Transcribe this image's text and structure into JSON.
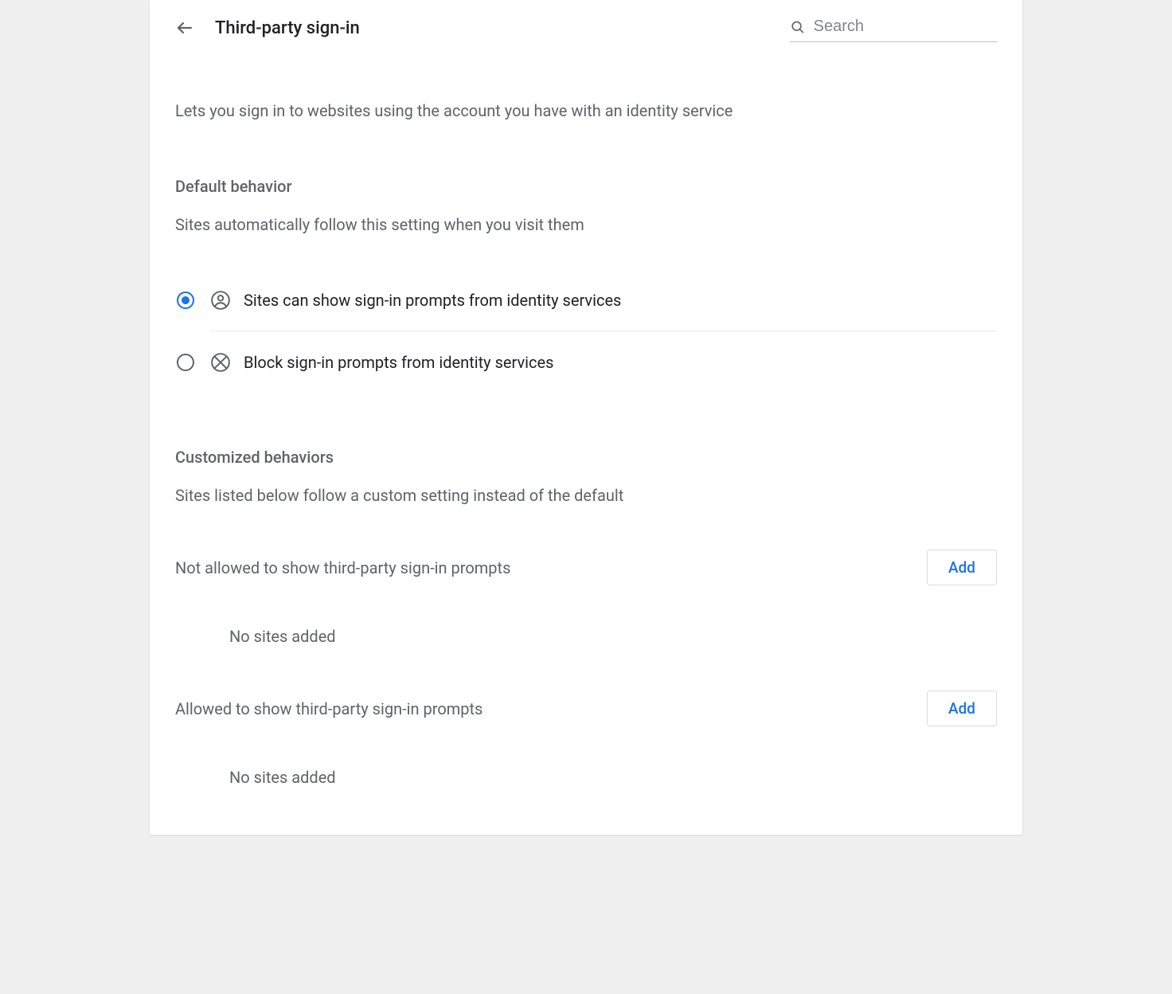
{
  "header": {
    "title": "Third-party sign-in",
    "search_placeholder": "Search"
  },
  "description": "Lets you sign in to websites using the account you have with an identity service",
  "default_section": {
    "title": "Default behavior",
    "subtitle": "Sites automatically follow this setting when you visit them",
    "options": [
      {
        "label": "Sites can show sign-in prompts from identity services",
        "selected": true
      },
      {
        "label": "Block sign-in prompts from identity services",
        "selected": false
      }
    ]
  },
  "custom_section": {
    "title": "Customized behaviors",
    "subtitle": "Sites listed below follow a custom setting instead of the default",
    "groups": [
      {
        "label": "Not allowed to show third-party sign-in prompts",
        "add_label": "Add",
        "empty_label": "No sites added"
      },
      {
        "label": "Allowed to show third-party sign-in prompts",
        "add_label": "Add",
        "empty_label": "No sites added"
      }
    ]
  }
}
